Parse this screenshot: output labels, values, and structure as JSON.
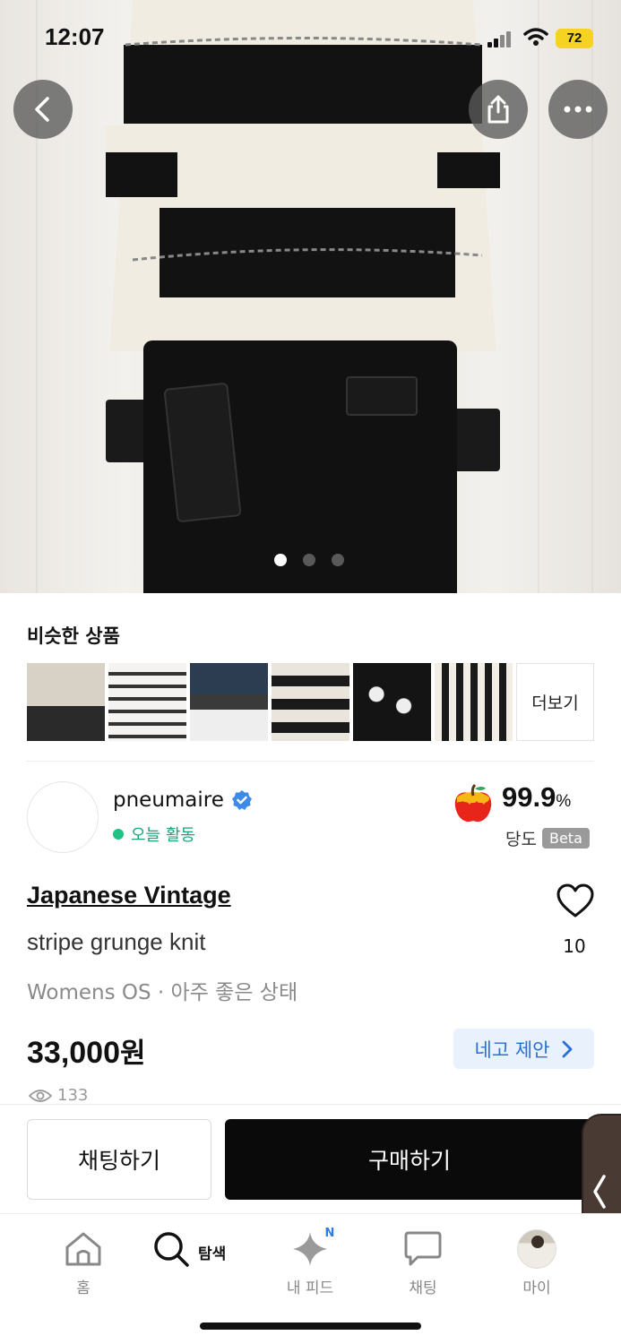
{
  "status_bar": {
    "time": "12:07",
    "battery": "72"
  },
  "hero": {
    "image_alt": "striped sweater",
    "page_count": 3,
    "active_page": 1
  },
  "similar": {
    "title": "비슷한 상품",
    "more_label": "더보기",
    "thumb_count": 6
  },
  "seller": {
    "name": "pneumaire",
    "activity": "오늘 활동",
    "score_value": "99.9",
    "score_unit": "%",
    "score_label": "당도",
    "beta": "Beta"
  },
  "product": {
    "brand": "Japanese Vintage",
    "name": "stripe grunge knit",
    "condition": "Womens OS · 아주 좋은 상태",
    "likes": "10",
    "price_number": "33,000",
    "price_unit": "원",
    "offer_label": "네고 제안",
    "views": "133"
  },
  "actions": {
    "chat_label": "채팅하기",
    "buy_label": "구매하기"
  },
  "tabs": [
    {
      "label": "홈",
      "icon": "home-icon"
    },
    {
      "label": "탐색",
      "icon": "search-icon"
    },
    {
      "label": "내 피드",
      "icon": "sparkle-icon",
      "badge": "N"
    },
    {
      "label": "채팅",
      "icon": "chat-icon"
    },
    {
      "label": "마이",
      "icon": "avatar"
    }
  ],
  "colors": {
    "accent_blue": "#2a6fd6",
    "active_green": "#20c283",
    "battery_yellow": "#f5d320"
  }
}
